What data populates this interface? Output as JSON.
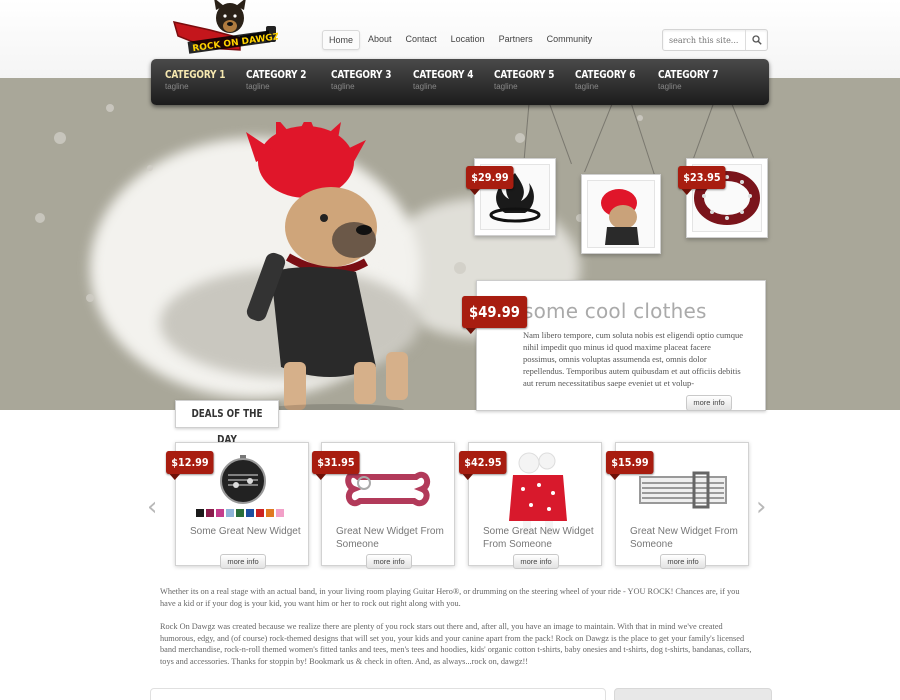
{
  "header": {
    "logo_text": "ROCK ON DAWGZ",
    "nav": [
      {
        "label": "Home",
        "active": true
      },
      {
        "label": "About"
      },
      {
        "label": "Contact"
      },
      {
        "label": "Location"
      },
      {
        "label": "Partners"
      },
      {
        "label": "Community"
      }
    ],
    "search": {
      "placeholder": "search this site..."
    }
  },
  "categories": [
    {
      "name": "CATEGORY 1",
      "tagline": "tagline",
      "active": true
    },
    {
      "name": "CATEGORY 2",
      "tagline": "tagline"
    },
    {
      "name": "CATEGORY 3",
      "tagline": "tagline"
    },
    {
      "name": "CATEGORY 4",
      "tagline": "tagline"
    },
    {
      "name": "CATEGORY 5",
      "tagline": "tagline"
    },
    {
      "name": "CATEGORY 6",
      "tagline": "tagline"
    },
    {
      "name": "CATEGORY 7",
      "tagline": "tagline"
    }
  ],
  "hero": {
    "frames": [
      {
        "price": "$29.99",
        "icon": "studded-collar-flame-icon"
      },
      {
        "price": "",
        "icon": "punk-dog-thumbnail"
      },
      {
        "price": "$23.95",
        "icon": "red-spiked-collar-icon"
      }
    ],
    "feature": {
      "price": "$49.99",
      "title": "some cool clothes",
      "text": "Nam libero tempore, cum soluta nobis est eligendi optio cumque nihil impedit quo minus id quod maxime placeat facere possimus, omnis voluptas assumenda est, omnis dolor repellendus. Temporibus autem quibusdam et aut officiis debitis aut rerum necessitatibus saepe eveniet ut et volup-",
      "button": "more info"
    }
  },
  "deals": {
    "label": "DEALS OF THE DAY",
    "items": [
      {
        "price": "$12.99",
        "title": "Some Great New Widget",
        "button": "more info",
        "icon": "music-pet-tag-icon"
      },
      {
        "price": "$31.95",
        "title": "Great New Widget From Someone",
        "button": "more info",
        "icon": "bone-keychain-icon"
      },
      {
        "price": "$42.95",
        "title": "Some Great New Widget From Someone",
        "button": "more info",
        "icon": "red-dog-sweater-icon"
      },
      {
        "price": "$15.99",
        "title": "Great New Widget From Someone",
        "button": "more info",
        "icon": "music-collar-icon"
      }
    ],
    "swatches": [
      "#1a1a1a",
      "#8a1c4b",
      "#c53c8c",
      "#8fb4d8",
      "#2a6f3a",
      "#1e4fa0",
      "#c22",
      "#e07a20",
      "#f2a0c8"
    ]
  },
  "body": {
    "p1": "Whether its on a real stage with an actual band, in your living room playing Guitar Hero®, or drumming on the steering wheel of your ride - YOU ROCK! Chances are, if you have a kid or if your dog is your kid, you want him or her to rock out right along with you.",
    "p2": "Rock On Dawgz was created because we realize there are plenty of you rock stars out there and, after all, you have an image to maintain. With that in mind we've created humorous, edgy, and (of course) rock-themed designs that will set you, your kids and your canine apart from the pack! Rock on Dawgz is the place to get your family's licensed band merchandise, rock-n-roll themed women's fitted tanks and tees, men's tees and hoodies, kids' organic cotton t-shirts, baby onesies and t-shirts, dog t-shirts, bandanas, collars, toys and accessories.  Thanks for stoppin by! Bookmark us & check in often. And, as always...rock on, dawgz!!"
  }
}
